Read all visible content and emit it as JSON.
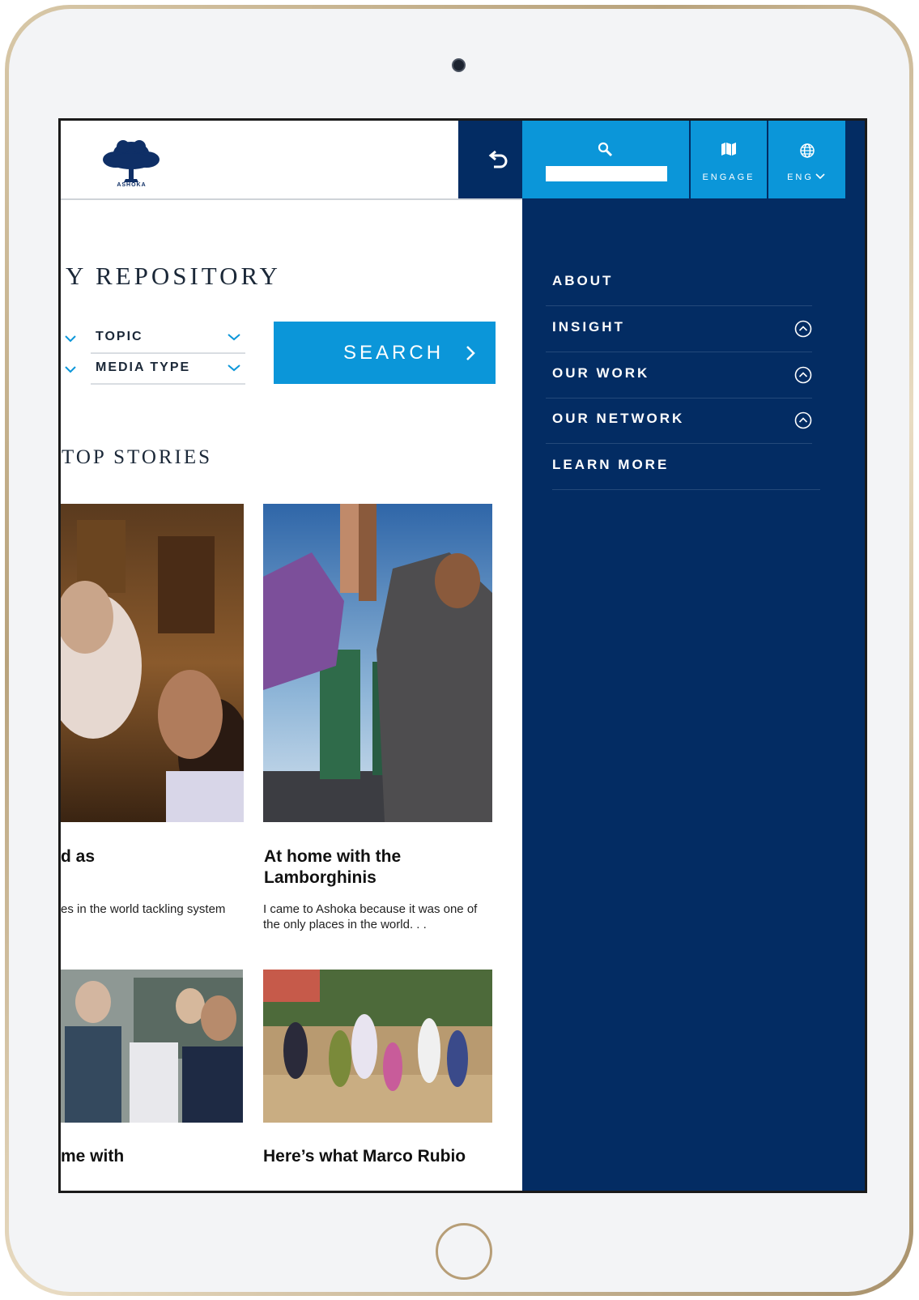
{
  "header": {
    "logo_text": "ASHOKA"
  },
  "page": {
    "repository_title": "Y REPOSITORY",
    "filters": [
      {
        "label": "TOPIC"
      },
      {
        "label": "MEDIA TYPE"
      }
    ],
    "search_button_label": "SEARCH",
    "top_stories_heading": "TOP STORIES",
    "cards": [
      {
        "title": "d as",
        "excerpt": "es in the world tackling system"
      },
      {
        "title": "At home with the Lamborghinis",
        "excerpt": "I came to Ashoka because it was one of the only places in the world. . ."
      },
      {
        "title": "me with",
        "excerpt": ""
      },
      {
        "title": "Here’s what Marco Rubio",
        "excerpt": ""
      }
    ]
  },
  "menu": {
    "topbar": {
      "search_placeholder": "",
      "engage_label": "ENGAGE",
      "language_label": "ENG"
    },
    "items": [
      {
        "label": "ABOUT",
        "expandable": false
      },
      {
        "label": "INSIGHT",
        "expandable": true
      },
      {
        "label": "OUR WORK",
        "expandable": true
      },
      {
        "label": "OUR NETWORK",
        "expandable": true
      },
      {
        "label": "LEARN MORE",
        "expandable": false
      }
    ]
  },
  "colors": {
    "navy": "#032c63",
    "accent_blue": "#0b96d9"
  }
}
